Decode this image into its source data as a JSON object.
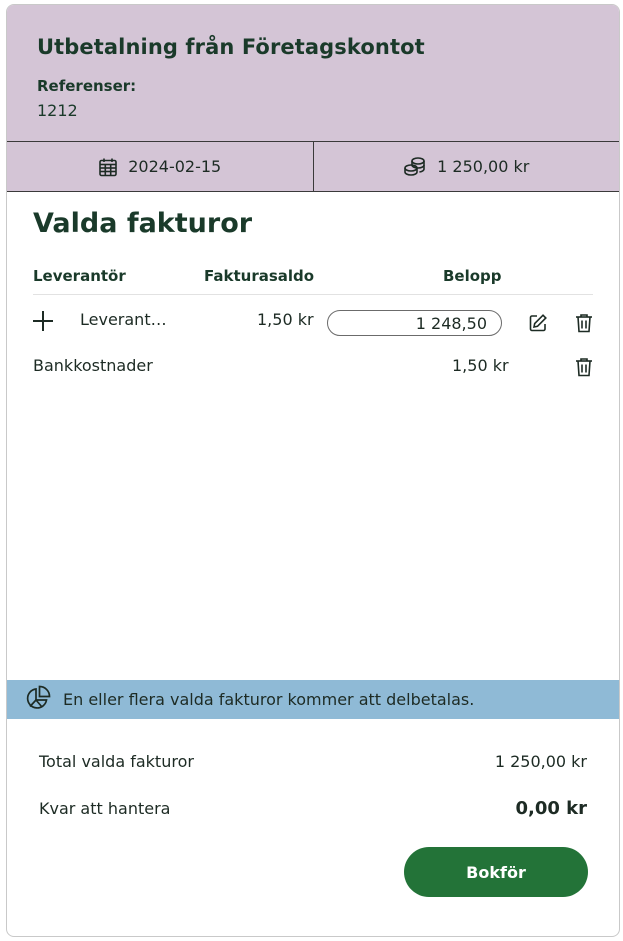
{
  "header": {
    "title": "Utbetalning från Företagskontot",
    "references_label": "Referenser:",
    "references_value": "1212"
  },
  "infobar": {
    "date": "2024-02-15",
    "amount": "1 250,00 kr",
    "date_icon": "calendar-icon",
    "amount_icon": "coins-icon"
  },
  "section": {
    "title": "Valda fakturor",
    "columns": {
      "supplier": "Leverantör",
      "invoice_balance": "Fakturasaldo",
      "amount": "Belopp"
    }
  },
  "rows": [
    {
      "supplier": "Leverant…",
      "invoice_balance": "1,50 kr",
      "amount_value": "1 248,50"
    },
    {
      "supplier": "Bankkostnader",
      "amount": "1,50 kr"
    }
  ],
  "notice": {
    "text": "En eller flera valda fakturor kommer att delbetalas.",
    "icon": "pie-chart-icon"
  },
  "totals": {
    "selected_label": "Total valda fakturor",
    "selected_value": "1 250,00 kr",
    "remaining_label": "Kvar att hantera",
    "remaining_value": "0,00 kr"
  },
  "actions": {
    "submit_label": "Bokför"
  },
  "colors": {
    "header_bg": "#d4c5d6",
    "notice_bg": "#8fbad6",
    "primary_button": "#237338",
    "title_text": "#1a3a2a"
  }
}
